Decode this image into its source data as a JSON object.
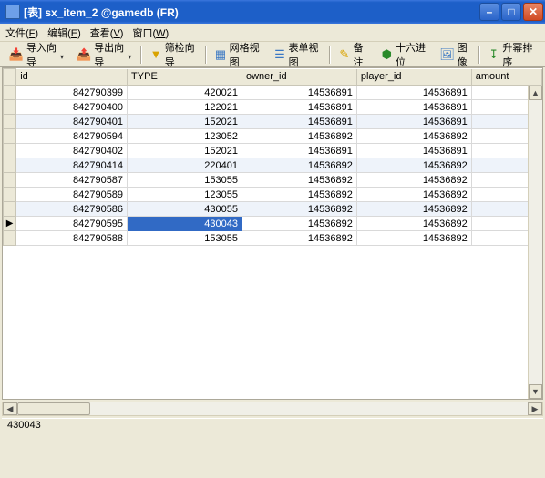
{
  "window": {
    "title": "[表] sx_item_2 @gamedb (FR)"
  },
  "menu": {
    "file": "文件",
    "file_u": "F",
    "edit": "编辑",
    "edit_u": "E",
    "view": "查看",
    "view_u": "V",
    "window": "窗口",
    "window_u": "W"
  },
  "toolbar": {
    "import": "导入向导",
    "export": "导出向导",
    "filter": "筛检向导",
    "grid": "网格视图",
    "form": "表单视图",
    "note": "备注",
    "hex": "十六进位",
    "image": "图像",
    "sort": "升幂排序"
  },
  "columns": [
    "id",
    "TYPE",
    "owner_id",
    "player_id",
    "amount"
  ],
  "rows": [
    {
      "id": "842790399",
      "type": "420021",
      "owner": "14536891",
      "player": "14536891",
      "amount": ""
    },
    {
      "id": "842790400",
      "type": "122021",
      "owner": "14536891",
      "player": "14536891",
      "amount": ""
    },
    {
      "id": "842790401",
      "type": "152021",
      "owner": "14536891",
      "player": "14536891",
      "amount": ""
    },
    {
      "id": "842790594",
      "type": "123052",
      "owner": "14536892",
      "player": "14536892",
      "amount": ""
    },
    {
      "id": "842790402",
      "type": "152021",
      "owner": "14536891",
      "player": "14536891",
      "amount": ""
    },
    {
      "id": "842790414",
      "type": "220401",
      "owner": "14536892",
      "player": "14536892",
      "amount": ""
    },
    {
      "id": "842790587",
      "type": "153055",
      "owner": "14536892",
      "player": "14536892",
      "amount": ""
    },
    {
      "id": "842790589",
      "type": "123055",
      "owner": "14536892",
      "player": "14536892",
      "amount": ""
    },
    {
      "id": "842790586",
      "type": "430055",
      "owner": "14536892",
      "player": "14536892",
      "amount": ""
    },
    {
      "id": "842790595",
      "type": "430043",
      "owner": "14536892",
      "player": "14536892",
      "amount": ""
    },
    {
      "id": "842790588",
      "type": "153055",
      "owner": "14536892",
      "player": "14536892",
      "amount": ""
    }
  ],
  "zebra_rows": [
    2,
    5,
    8
  ],
  "selected_row": 9,
  "selected_col": "type",
  "status": "430043"
}
